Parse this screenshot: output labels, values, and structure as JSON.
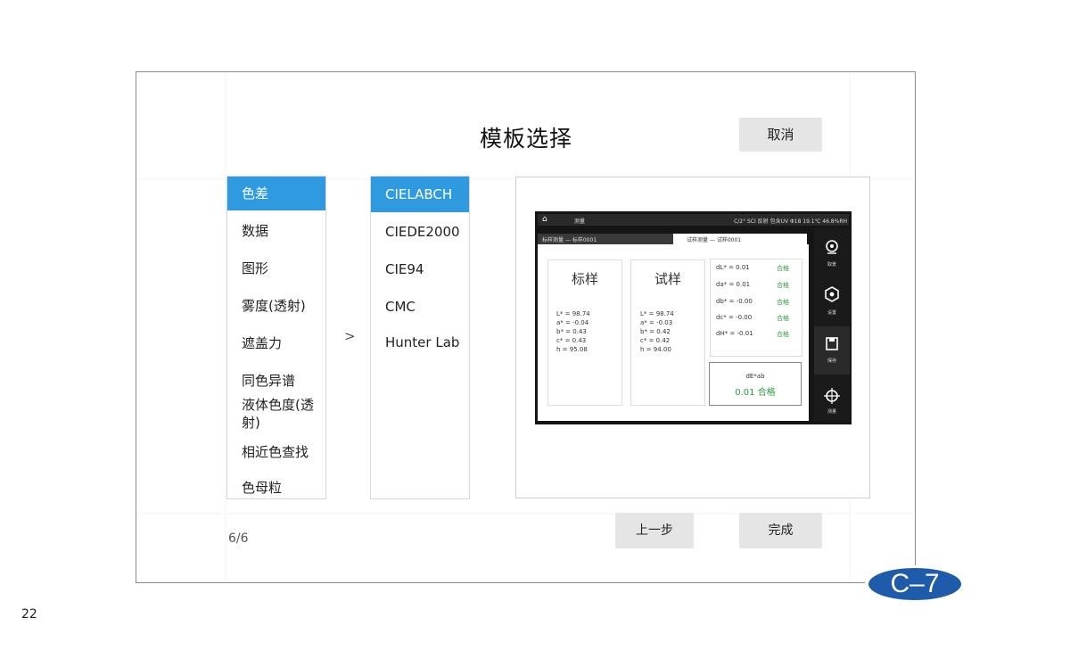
{
  "dialog": {
    "title": "模板选择",
    "cancel_label": "取消",
    "prev_label": "上一步",
    "done_label": "完成",
    "page_indicator": "6/6"
  },
  "categories": [
    {
      "label": "色差",
      "selected": true
    },
    {
      "label": "数据"
    },
    {
      "label": "图形"
    },
    {
      "label": "雾度(透射)"
    },
    {
      "label": "遮盖力"
    },
    {
      "label": "同色异谱"
    },
    {
      "label": "液体色度(透射)"
    },
    {
      "label": "相近色查找"
    },
    {
      "label": "色母粒"
    }
  ],
  "formulas": [
    {
      "label": "CIELABCH",
      "selected": true
    },
    {
      "label": "CIEDE2000"
    },
    {
      "label": "CIE94"
    },
    {
      "label": "CMC"
    },
    {
      "label": "Hunter Lab"
    }
  ],
  "arrow": ">",
  "preview": {
    "header_left": "测量",
    "header_right": "C/2°  SCI  反射  包含UV  Φ18  19.1℃  46.8%RH",
    "tab_left": "标样测量 — 标样0001",
    "tab_right": "试样测量 — 试样0001",
    "standard_title": "标样",
    "standard_values": [
      "L* =  98.74",
      "a* =  -0.04",
      "b* =  0.43",
      "c* =  0.43",
      "h  =  95.08"
    ],
    "sample_title": "试样",
    "sample_values": [
      "L* =  98.74",
      "a* =  -0.03",
      "b* =  0.42",
      "c* =  0.42",
      "h  =  94.00"
    ],
    "diffs": [
      {
        "label": "dL* =  0.01",
        "result": "合格"
      },
      {
        "label": "da* =  0.01",
        "result": "合格"
      },
      {
        "label": "db* =  -0.00",
        "result": "合格"
      },
      {
        "label": "dc* =  -0.00",
        "result": "合格"
      },
      {
        "label": "dH* =  -0.01",
        "result": "合格"
      }
    ],
    "de_label": "dE*ab",
    "de_value": "0.01 合格",
    "sidebar": [
      "取景",
      "设置",
      "保存",
      "测量"
    ]
  },
  "page_number": "22",
  "badge": "C–7",
  "colors": {
    "accent": "#2f9ae0",
    "badge": "#1e5cab",
    "pass": "#2a9a3a"
  }
}
